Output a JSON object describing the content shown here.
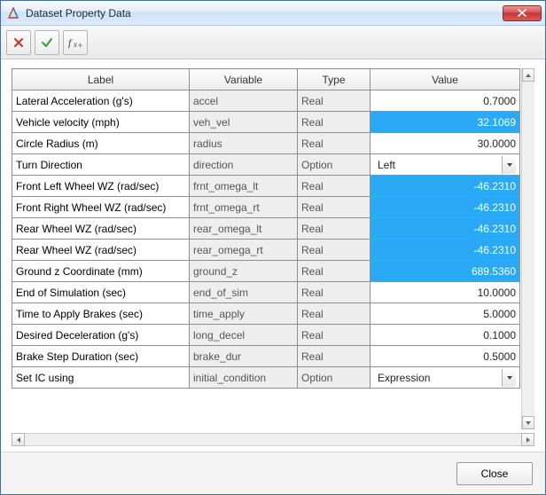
{
  "window": {
    "title": "Dataset Property Data"
  },
  "columns": {
    "label": "Label",
    "variable": "Variable",
    "type": "Type",
    "value": "Value"
  },
  "types": {
    "real": "Real",
    "option": "Option"
  },
  "rows": [
    {
      "label": "Lateral Acceleration (g's)",
      "variable": "accel",
      "type": "real",
      "value": "0.7000",
      "highlight": false
    },
    {
      "label": "Vehicle velocity (mph)",
      "variable": "veh_vel",
      "type": "real",
      "value": "32.1069",
      "highlight": true
    },
    {
      "label": "Circle Radius (m)",
      "variable": "radius",
      "type": "real",
      "value": "30.0000",
      "highlight": false
    },
    {
      "label": "Turn Direction",
      "variable": "direction",
      "type": "option",
      "value": "Left",
      "highlight": false
    },
    {
      "label": "Front Left Wheel WZ (rad/sec)",
      "variable": "frnt_omega_lt",
      "type": "real",
      "value": "-46.2310",
      "highlight": true
    },
    {
      "label": "Front Right Wheel WZ (rad/sec)",
      "variable": "frnt_omega_rt",
      "type": "real",
      "value": "-46.2310",
      "highlight": true
    },
    {
      "label": "Rear Wheel WZ (rad/sec)",
      "variable": "rear_omega_lt",
      "type": "real",
      "value": "-46.2310",
      "highlight": true
    },
    {
      "label": "Rear Wheel WZ (rad/sec)",
      "variable": "rear_omega_rt",
      "type": "real",
      "value": "-46.2310",
      "highlight": true
    },
    {
      "label": "Ground z Coordinate (mm)",
      "variable": "ground_z",
      "type": "real",
      "value": "689.5360",
      "highlight": true
    },
    {
      "label": "End of Simulation (sec)",
      "variable": "end_of_sim",
      "type": "real",
      "value": "10.0000",
      "highlight": false
    },
    {
      "label": "Time to Apply Brakes (sec)",
      "variable": "time_apply",
      "type": "real",
      "value": "5.0000",
      "highlight": false
    },
    {
      "label": "Desired Deceleration (g's)",
      "variable": "long_decel",
      "type": "real",
      "value": "0.1000",
      "highlight": false
    },
    {
      "label": "Brake Step Duration (sec)",
      "variable": "brake_dur",
      "type": "real",
      "value": "0.5000",
      "highlight": false
    },
    {
      "label": "Set IC using",
      "variable": "initial_condition",
      "type": "option",
      "value": "Expression",
      "highlight": false
    }
  ],
  "footer": {
    "close_label": "Close"
  },
  "column_widths": {
    "label": 200,
    "variable": 122,
    "type": 82,
    "value": 169
  }
}
